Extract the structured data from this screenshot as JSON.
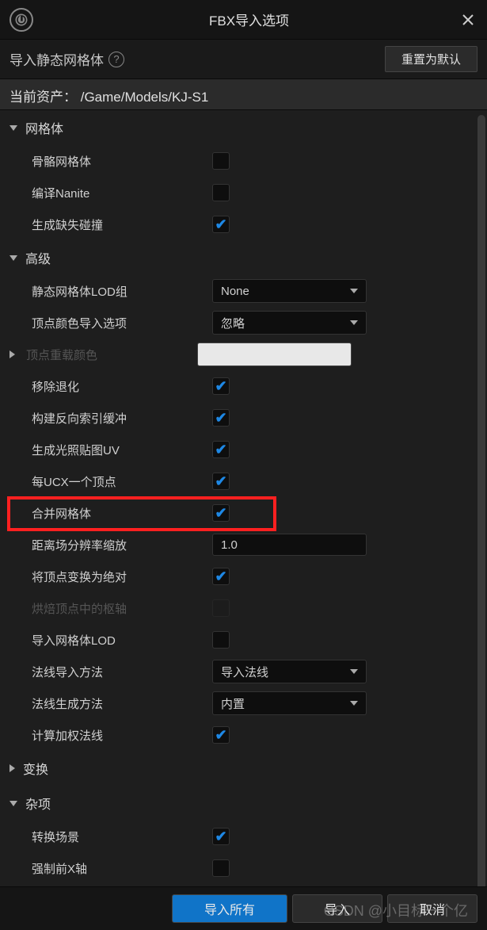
{
  "title": "FBX导入选项",
  "subheader": {
    "label": "导入静态网格体",
    "reset": "重置为默认"
  },
  "asset": {
    "label": "当前资产：",
    "path": "/Game/Models/KJ-S1"
  },
  "sections": {
    "mesh": "网格体",
    "advanced": "高级",
    "transform": "变换",
    "misc": "杂项"
  },
  "mesh": {
    "skeletal": "骨骼网格体",
    "nanite": "编译Nanite",
    "genCollision": "生成缺失碰撞"
  },
  "adv": {
    "lodGroup": "静态网格体LOD组",
    "lodGroupVal": "None",
    "vertexColorOpt": "顶点颜色导入选项",
    "vertexColorOptVal": "忽略",
    "vertexOverride": "顶点重载颜色",
    "removeDegen": "移除退化",
    "buildReversed": "构建反向索引缓冲",
    "genLightmap": "生成光照贴图UV",
    "oneUcxPerVert": "每UCX一个顶点",
    "combineMeshes": "合并网格体",
    "distFieldRes": "距离场分辨率缩放",
    "distFieldResVal": "1.0",
    "transformPivot": "将顶点变换为绝对",
    "bakePivot": "烘焙顶点中的枢轴",
    "importMeshLod": "导入网格体LOD",
    "normalImport": "法线导入方法",
    "normalImportVal": "导入法线",
    "normalGen": "法线生成方法",
    "normalGenVal": "内置",
    "computeWeighted": "计算加权法线"
  },
  "misc": {
    "convertScene": "转换场景",
    "forceFrontX": "强制前X轴"
  },
  "footer": {
    "importAll": "导入所有",
    "import": "导入",
    "cancel": "取消"
  },
  "watermark": "CSDN @小目标一个亿"
}
